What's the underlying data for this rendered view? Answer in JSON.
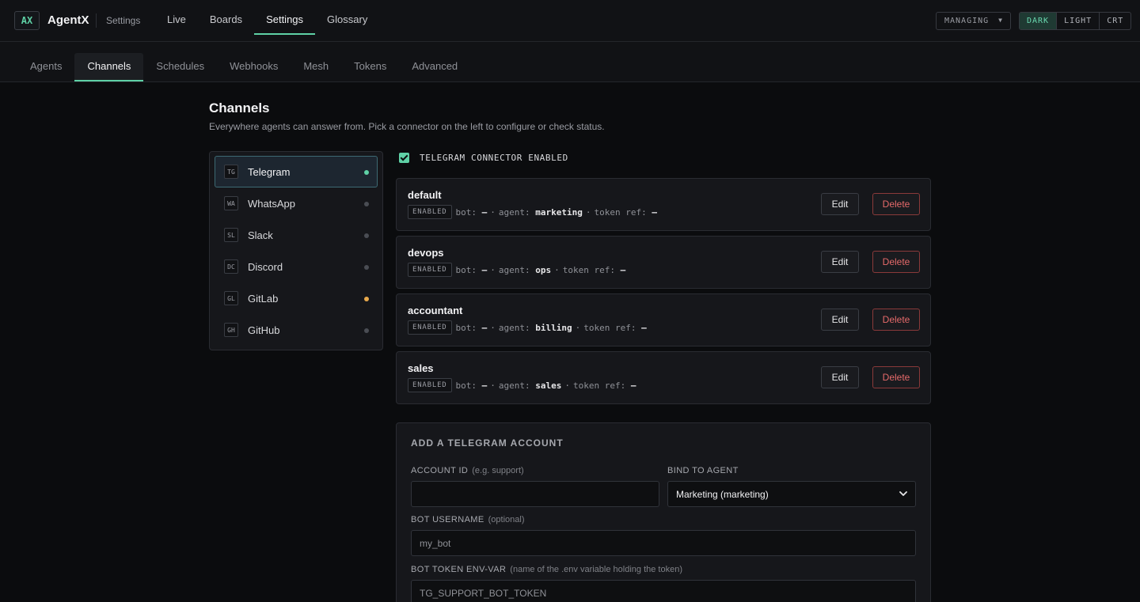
{
  "app": {
    "logo": "AX",
    "name": "AgentX",
    "section": "Settings"
  },
  "topnav": [
    {
      "label": "Live"
    },
    {
      "label": "Boards"
    },
    {
      "label": "Settings",
      "active": true
    },
    {
      "label": "Glossary"
    }
  ],
  "managing": {
    "label": "MANAGING"
  },
  "themes": [
    {
      "label": "DARK",
      "active": true
    },
    {
      "label": "LIGHT"
    },
    {
      "label": "CRT"
    }
  ],
  "subtabs": [
    {
      "label": "Agents"
    },
    {
      "label": "Channels",
      "active": true
    },
    {
      "label": "Schedules"
    },
    {
      "label": "Webhooks"
    },
    {
      "label": "Mesh"
    },
    {
      "label": "Tokens"
    },
    {
      "label": "Advanced"
    }
  ],
  "page": {
    "title": "Channels",
    "description": "Everywhere agents can answer from. Pick a connector on the left to configure or check status."
  },
  "connectors": [
    {
      "code": "TG",
      "name": "Telegram",
      "status_color": "#5fd1a6",
      "active": true
    },
    {
      "code": "WA",
      "name": "WhatsApp",
      "status_color": "#4a4d54"
    },
    {
      "code": "SL",
      "name": "Slack",
      "status_color": "#4a4d54"
    },
    {
      "code": "DC",
      "name": "Discord",
      "status_color": "#4a4d54"
    },
    {
      "code": "GL",
      "name": "GitLab",
      "status_color": "#e8a94c"
    },
    {
      "code": "GH",
      "name": "GitHub",
      "status_color": "#4a4d54"
    }
  ],
  "connector_enabled": {
    "label": "TELEGRAM CONNECTOR ENABLED",
    "checked": true
  },
  "accounts": [
    {
      "name": "default",
      "status": "ENABLED",
      "bot_label": "bot:",
      "bot": "—",
      "agent_label": "agent:",
      "agent": "marketing",
      "token_label": "token ref:",
      "token": "—",
      "edit": "Edit",
      "delete": "Delete"
    },
    {
      "name": "devops",
      "status": "ENABLED",
      "bot_label": "bot:",
      "bot": "—",
      "agent_label": "agent:",
      "agent": "ops",
      "token_label": "token ref:",
      "token": "—",
      "edit": "Edit",
      "delete": "Delete"
    },
    {
      "name": "accountant",
      "status": "ENABLED",
      "bot_label": "bot:",
      "bot": "—",
      "agent_label": "agent:",
      "agent": "billing",
      "token_label": "token ref:",
      "token": "—",
      "edit": "Edit",
      "delete": "Delete"
    },
    {
      "name": "sales",
      "status": "ENABLED",
      "bot_label": "bot:",
      "bot": "—",
      "agent_label": "agent:",
      "agent": "sales",
      "token_label": "token ref:",
      "token": "—",
      "edit": "Edit",
      "delete": "Delete"
    }
  ],
  "separator": "·",
  "add_form": {
    "title": "ADD A TELEGRAM ACCOUNT",
    "account_id": {
      "label": "ACCOUNT ID",
      "hint": "(e.g. support)",
      "value": ""
    },
    "bind_agent": {
      "label": "BIND TO AGENT",
      "value": "Marketing (marketing)"
    },
    "bot_username": {
      "label": "BOT USERNAME",
      "hint": "(optional)",
      "placeholder": "my_bot"
    },
    "bot_token": {
      "label": "BOT TOKEN ENV-VAR",
      "hint": "(name of the .env variable holding the token)",
      "placeholder": "TG_SUPPORT_BOT_TOKEN"
    }
  }
}
